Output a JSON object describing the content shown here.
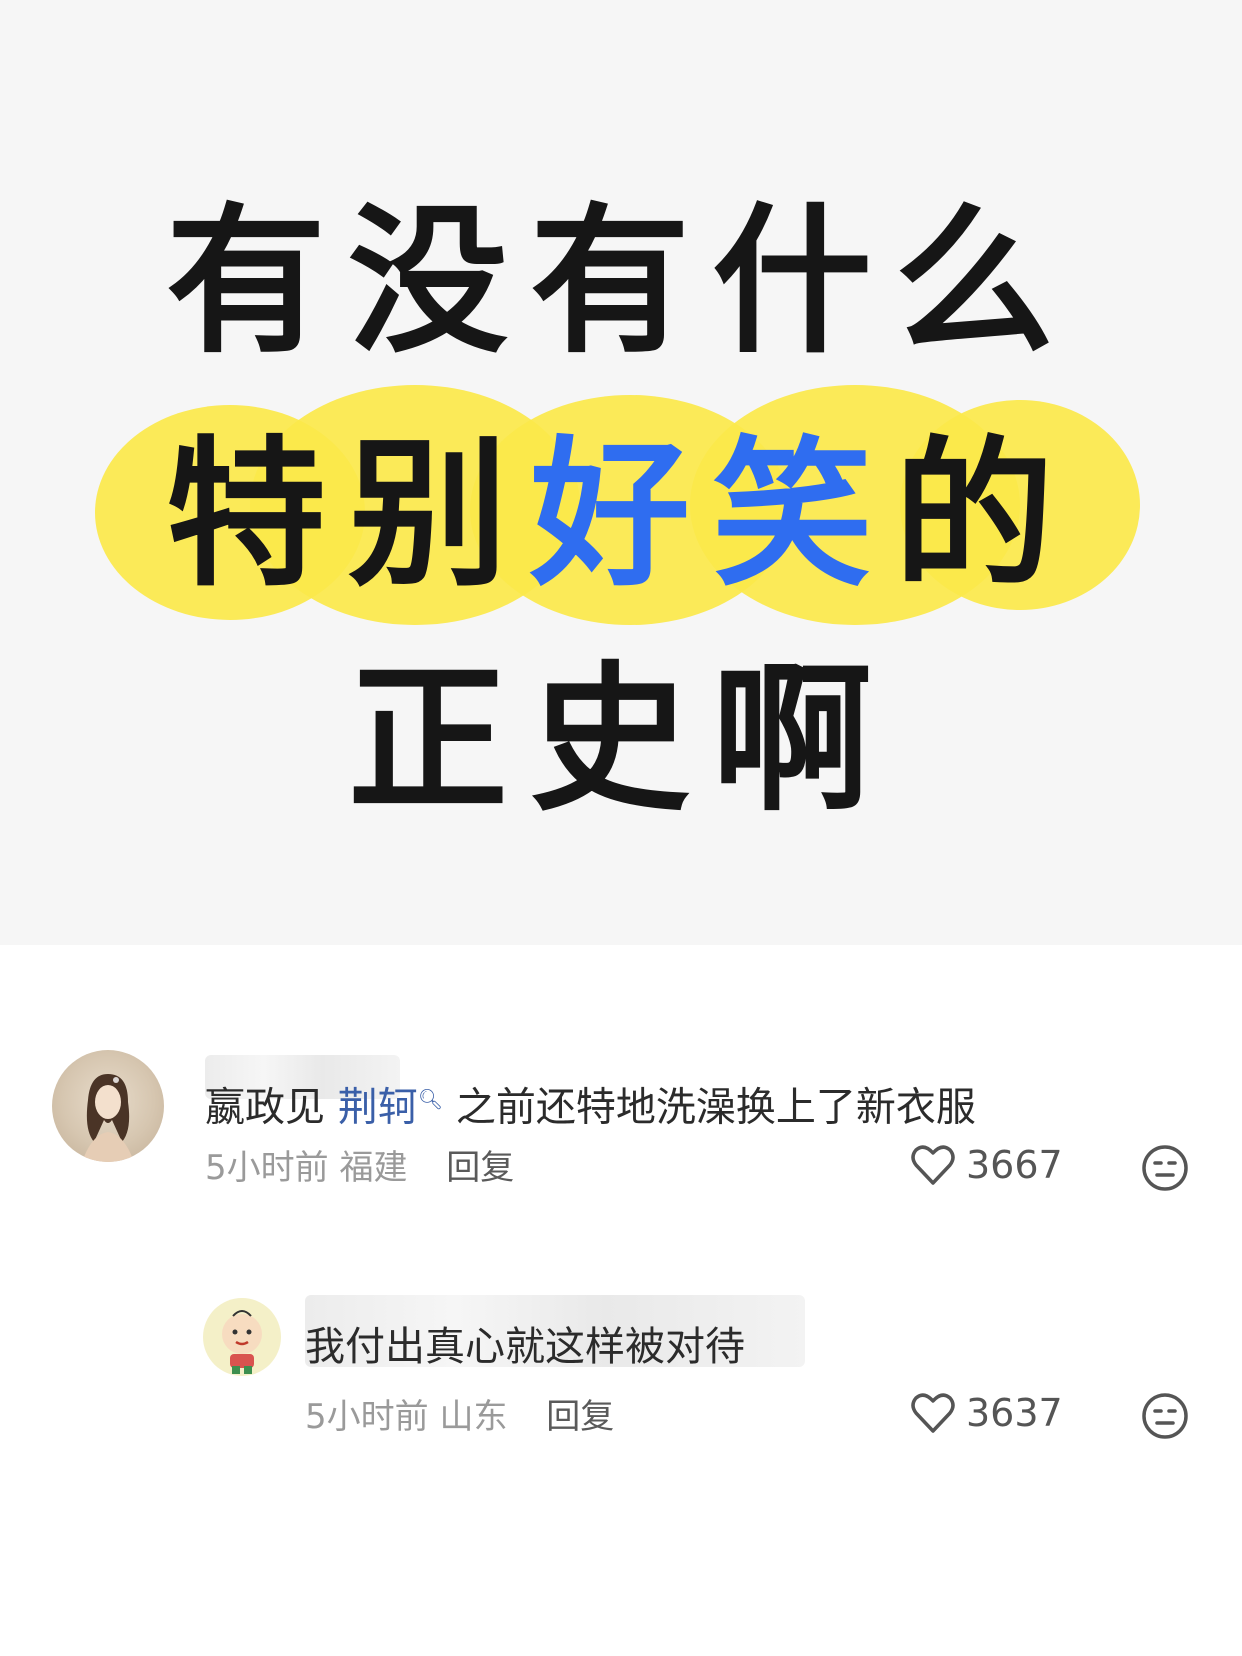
{
  "headline": {
    "line1": "有没有什么",
    "line2_pre": "特别",
    "line2_blue": "好笑",
    "line2_post": "的",
    "line3": "正史啊",
    "highlight_color": "#fbe84a",
    "accent_color": "#2f6df0"
  },
  "comments": [
    {
      "text_pre": "嬴政见 ",
      "mention": "荆轲",
      "text_post": " 之前还特地洗澡换上了新衣服",
      "time": "5小时前",
      "location": "福建",
      "reply_label": "回复",
      "likes": "3667"
    },
    {
      "text": "我付出真心就这样被对待",
      "time": "5小时前",
      "location": "山东",
      "reply_label": "回复",
      "likes": "3637"
    }
  ]
}
